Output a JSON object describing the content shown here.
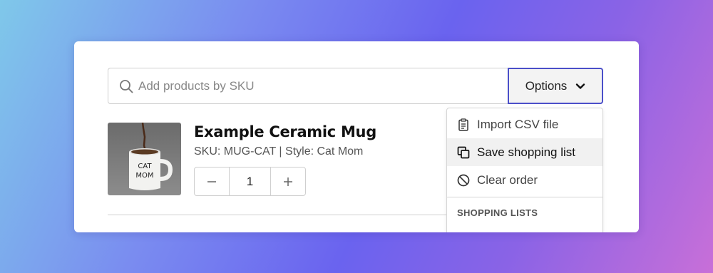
{
  "search": {
    "placeholder": "Add products by SKU",
    "icon": "search-icon"
  },
  "options_button": {
    "label": "Options",
    "icon": "chevron-down-icon"
  },
  "product": {
    "title": "Example Ceramic Mug",
    "meta": "SKU: MUG-CAT | Style: Cat Mom",
    "mug_text_line1": "CAT",
    "mug_text_line2": "MOM",
    "quantity": "1"
  },
  "menu": {
    "items": [
      {
        "label": "Import CSV file",
        "icon": "clipboard-icon"
      },
      {
        "label": "Save shopping list",
        "icon": "copy-icon"
      },
      {
        "label": "Clear order",
        "icon": "prohibited-icon"
      }
    ],
    "section_heading": "SHOPPING LISTS"
  },
  "colors": {
    "accent": "#4b4fc9",
    "hover_bg": "#f1f1f1",
    "border": "#cfcfcf"
  }
}
